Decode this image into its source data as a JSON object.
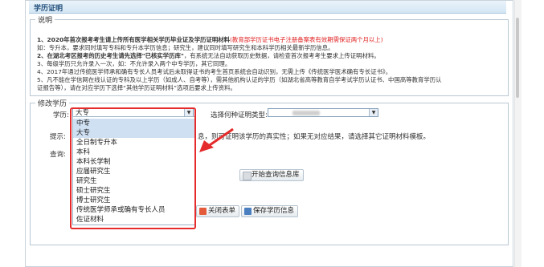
{
  "panel": {
    "title": "学历证明"
  },
  "notes": {
    "legend": "说明",
    "line1_prefix": "1、2020年首次报考考生请上传所有医学相关学历毕业证及学历证明材料",
    "line1_red": "(教育部学历证书电子注册备案表有效期需保证两个月以上)",
    "line2": "如：专升本，要求同时填写专科和专升本学历信息；研究生，建议同时填写研究生和本科学历相关最新学历信息。",
    "line3_prefix": "2、在湖北考区报考的历史考生请先选择\"已核实学历库\"",
    "line3_rest": "，有系统无法自动获取历史数据，请检查首次报考考生要求上传证明材料。",
    "line4": "3、每级学历只允许录入一次，如：不允许录入两个中专学历，其它同理。",
    "line5": "4、2017年通过传统医学师承和确有专长人员考试后未取得证书的考生首页系统会自动识别，无需上传《传统医学医术确有专长证书》。",
    "line6": "5、凡不能在学信网在线认证的专科及以上学历（如成人、自考等），需其他机构认证的学历（如湖北省高等教育自学考试学历认证书、中国高等教育学历认",
    "line7": "证报告等），请在对应学历下选择“其他学历证明材料”选项后要求上传资料。"
  },
  "edit": {
    "legend": "修改学历",
    "level_label": "学历:",
    "level_selected": "大专",
    "type_label": "选择何种证明类型:",
    "tip_label": "提示:",
    "tip_text": "息，则可证明该学历的真实性；如果无对应结果，请选择其它证明材料模板。",
    "query_label": "查询:"
  },
  "dropdown_options": [
    "中专",
    "大专",
    "全日制专升本",
    "本科",
    "本科长学制",
    "应届研究生",
    "研究生",
    "硕士研究生",
    "博士研究生",
    "传统医学师承或确有专长人员",
    "佐证材料"
  ],
  "buttons": {
    "query_db": "开始查询信息库",
    "close": "关闭表单",
    "save": "保存学历信息"
  },
  "colors": {
    "accent_red": "#e52b2b",
    "title_blue": "#1f4d7a"
  }
}
